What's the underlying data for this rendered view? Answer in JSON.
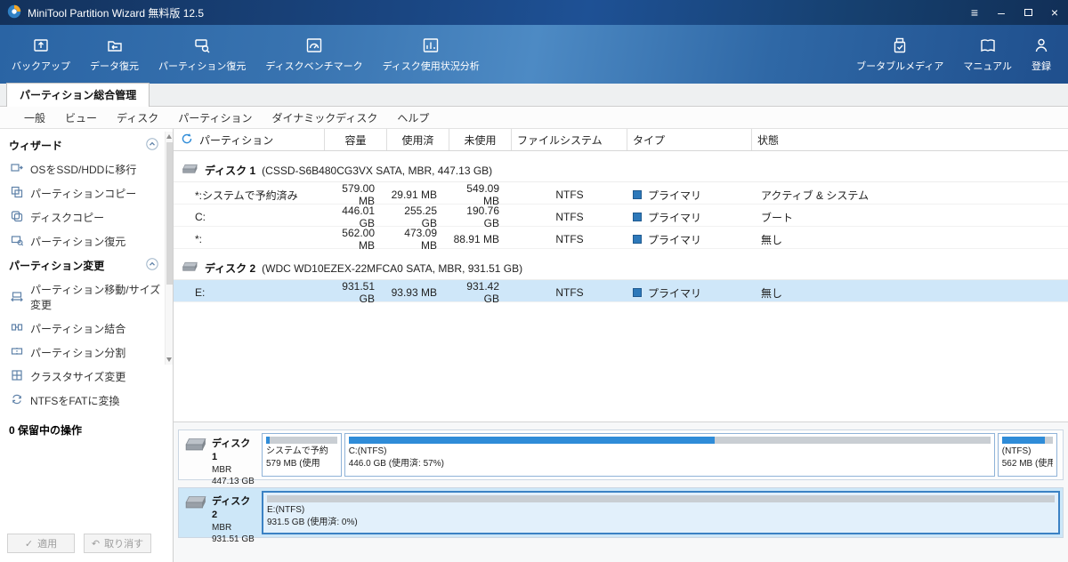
{
  "titlebar": {
    "title": "MiniTool Partition Wizard 無料版 12.5"
  },
  "icons": {
    "menu": "≡",
    "minimize": "–",
    "close": "×",
    "apply_check": "✓",
    "undo_arrow": "↶"
  },
  "toolbar": {
    "left": [
      {
        "label": "バックアップ"
      },
      {
        "label": "データ復元"
      },
      {
        "label": "パーティション復元"
      },
      {
        "label": "ディスクベンチマーク"
      },
      {
        "label": "ディスク使用状況分析"
      }
    ],
    "right": [
      {
        "label": "ブータブルメディア"
      },
      {
        "label": "マニュアル"
      },
      {
        "label": "登録"
      }
    ]
  },
  "tabs": {
    "active": "パーティション総合管理"
  },
  "menubar": {
    "items": [
      {
        "label": "一般"
      },
      {
        "label": "ビュー"
      },
      {
        "label": "ディスク"
      },
      {
        "label": "パーティション"
      },
      {
        "label": "ダイナミックディスク"
      },
      {
        "label": "ヘルプ"
      }
    ]
  },
  "sidebar": {
    "sections": [
      {
        "title": "ウィザード",
        "items": [
          {
            "label": "OSをSSD/HDDに移行"
          },
          {
            "label": "パーティションコピー"
          },
          {
            "label": "ディスクコピー"
          },
          {
            "label": "パーティション復元"
          }
        ]
      },
      {
        "title": "パーティション変更",
        "items": [
          {
            "label": "パーティション移動/サイズ変更"
          },
          {
            "label": "パーティション結合"
          },
          {
            "label": "パーティション分割"
          },
          {
            "label": "クラスタサイズ変更"
          },
          {
            "label": "NTFSをFATに変換"
          }
        ]
      }
    ],
    "pending_operations": "0 保留中の操作",
    "apply_button": "適用",
    "undo_button": "取り消す"
  },
  "table": {
    "headers": {
      "partition": "パーティション",
      "capacity": "容量",
      "used": "使用済",
      "unused": "未使用",
      "filesystem": "ファイルシステム",
      "type": "タイプ",
      "status": "状態"
    },
    "disks": [
      {
        "name": "ディスク 1",
        "info": "(CSSD-S6B480CG3VX SATA, MBR, 447.13 GB)",
        "partitions": [
          {
            "name": "*:システムで予約済み",
            "capacity": "579.00 MB",
            "used": "29.91 MB",
            "unused": "549.09 MB",
            "filesystem": "NTFS",
            "type": "プライマリ",
            "status": "アクティブ & システム"
          },
          {
            "name": "C:",
            "capacity": "446.01 GB",
            "used": "255.25 GB",
            "unused": "190.76 GB",
            "filesystem": "NTFS",
            "type": "プライマリ",
            "status": "ブート"
          },
          {
            "name": "*:",
            "capacity": "562.00 MB",
            "used": "473.09 MB",
            "unused": "88.91 MB",
            "filesystem": "NTFS",
            "type": "プライマリ",
            "status": "無し"
          }
        ]
      },
      {
        "name": "ディスク 2",
        "info": "(WDC WD10EZEX-22MFCA0 SATA, MBR, 931.51 GB)",
        "partitions": [
          {
            "name": "E:",
            "capacity": "931.51 GB",
            "used": "93.93 MB",
            "unused": "931.42 GB",
            "filesystem": "NTFS",
            "type": "プライマリ",
            "status": "無し"
          }
        ]
      }
    ]
  },
  "diskmap": {
    "disks": [
      {
        "name": "ディスク 1",
        "scheme": "MBR",
        "size": "447.13 GB",
        "segments": [
          {
            "line1": "システムで予約",
            "line2": "579 MB (使用",
            "width_pct": 10,
            "used_pct": 5
          },
          {
            "line1": "C:(NTFS)",
            "line2": "446.0 GB (使用済: 57%)",
            "width_pct": 81.5,
            "used_pct": 57
          },
          {
            "line1": "(NTFS)",
            "line2": "562 MB (使用",
            "width_pct": 7.5,
            "used_pct": 84
          }
        ]
      },
      {
        "name": "ディスク 2",
        "scheme": "MBR",
        "size": "931.51 GB",
        "segments": [
          {
            "line1": "E:(NTFS)",
            "line2": "931.5 GB (使用済: 0%)",
            "width_pct": 100,
            "used_pct": 0
          }
        ]
      }
    ]
  },
  "colors": {
    "accent_blue": "#2f8cd8",
    "selected_row": "#cfe7f9",
    "type_square": "#2e79ba"
  }
}
